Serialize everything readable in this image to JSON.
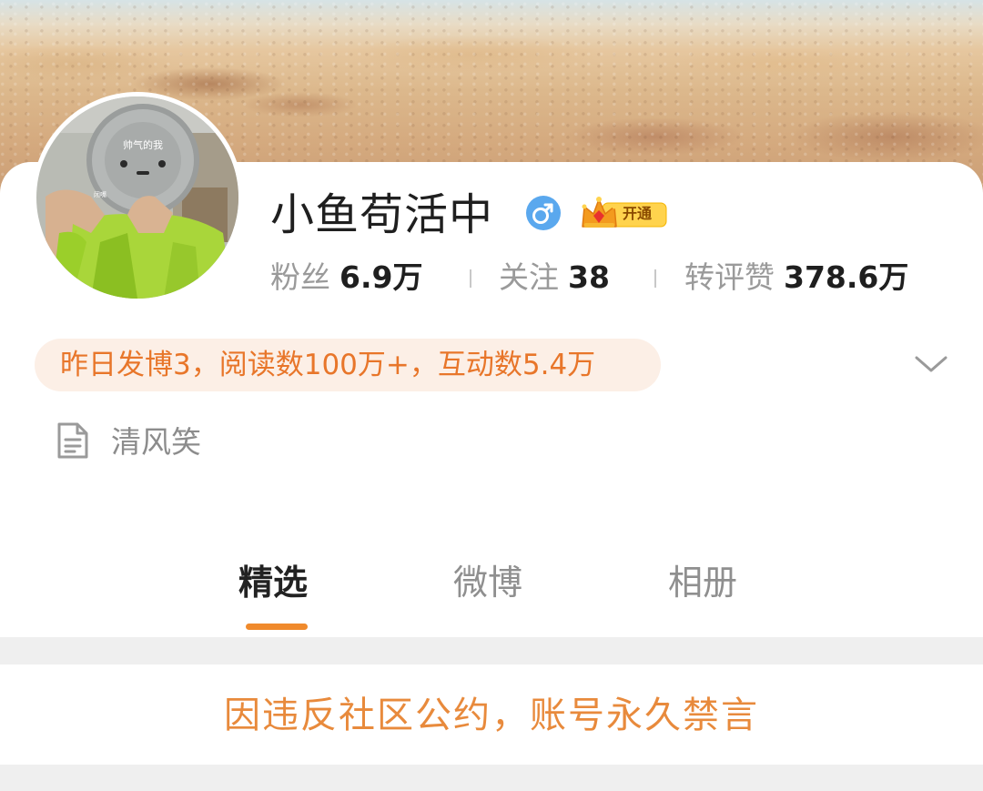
{
  "profile": {
    "name": "小鱼苟活中",
    "gender_icon": "male-icon",
    "vip_badge_label": "开通",
    "avatar_caption_top": "帅气的我",
    "avatar_caption_small": "闭嘴"
  },
  "stats": {
    "fans_label": "粉丝",
    "fans_value": "6.9万",
    "following_label": "关注",
    "following_value": "38",
    "likes_label": "转评赞",
    "likes_value": "378.6万"
  },
  "summary": {
    "text": "昨日发博3，阅读数100万+，互动数5.4万",
    "expand_icon": "chevron-down-icon"
  },
  "bio": {
    "icon": "document-icon",
    "text": "清风笑"
  },
  "tabs": [
    {
      "label": "精选",
      "active": true
    },
    {
      "label": "微博",
      "active": false
    },
    {
      "label": "相册",
      "active": false
    }
  ],
  "notice": {
    "text": "因违反社区公约，账号永久禁言"
  },
  "colors": {
    "accent": "#f08a2c",
    "notice_text": "#e88a3c",
    "summary_bg": "#fcefe6",
    "summary_text": "#e8762a",
    "male_icon_bg": "#5aa8ee"
  }
}
